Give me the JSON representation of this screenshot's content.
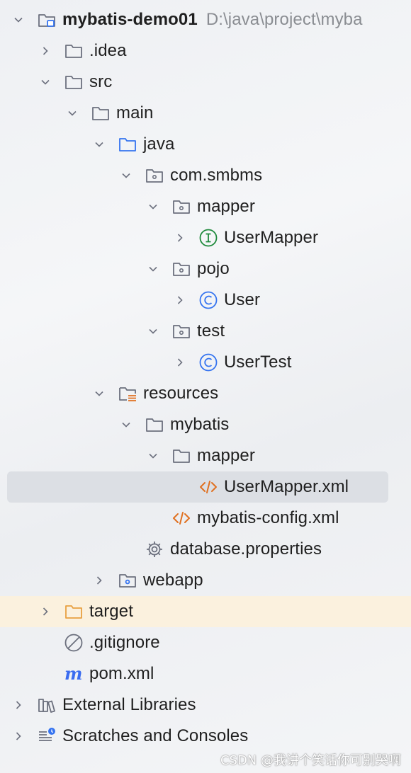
{
  "project_tree": {
    "root": {
      "label": "mybatis-demo01",
      "path": "D:\\java\\project\\myba"
    },
    "items": [
      {
        "label": ".idea"
      },
      {
        "label": "src"
      },
      {
        "label": "main"
      },
      {
        "label": "java"
      },
      {
        "label": "com.smbms"
      },
      {
        "label": "mapper"
      },
      {
        "label": "UserMapper"
      },
      {
        "label": "pojo"
      },
      {
        "label": "User"
      },
      {
        "label": "test"
      },
      {
        "label": "UserTest"
      },
      {
        "label": "resources"
      },
      {
        "label": "mybatis"
      },
      {
        "label": "mapper"
      },
      {
        "label": "UserMapper.xml"
      },
      {
        "label": "mybatis-config.xml"
      },
      {
        "label": "database.properties"
      },
      {
        "label": "webapp"
      },
      {
        "label": "target"
      },
      {
        "label": ".gitignore"
      },
      {
        "label": "pom.xml"
      },
      {
        "label": "External Libraries"
      },
      {
        "label": "Scratches and Consoles"
      }
    ]
  },
  "colors": {
    "selected_row": "#dcdfe4",
    "target_row": "#fbf1de",
    "source_folder": "#3574f0",
    "interface_icon": "#1f8a3c",
    "class_icon": "#3574f0",
    "xml_icon": "#e07020",
    "excluded_folder": "#e8a040",
    "maven_icon": "#3a6cf0"
  },
  "watermark": "CSDN @我讲个笑话你可别哭啊"
}
